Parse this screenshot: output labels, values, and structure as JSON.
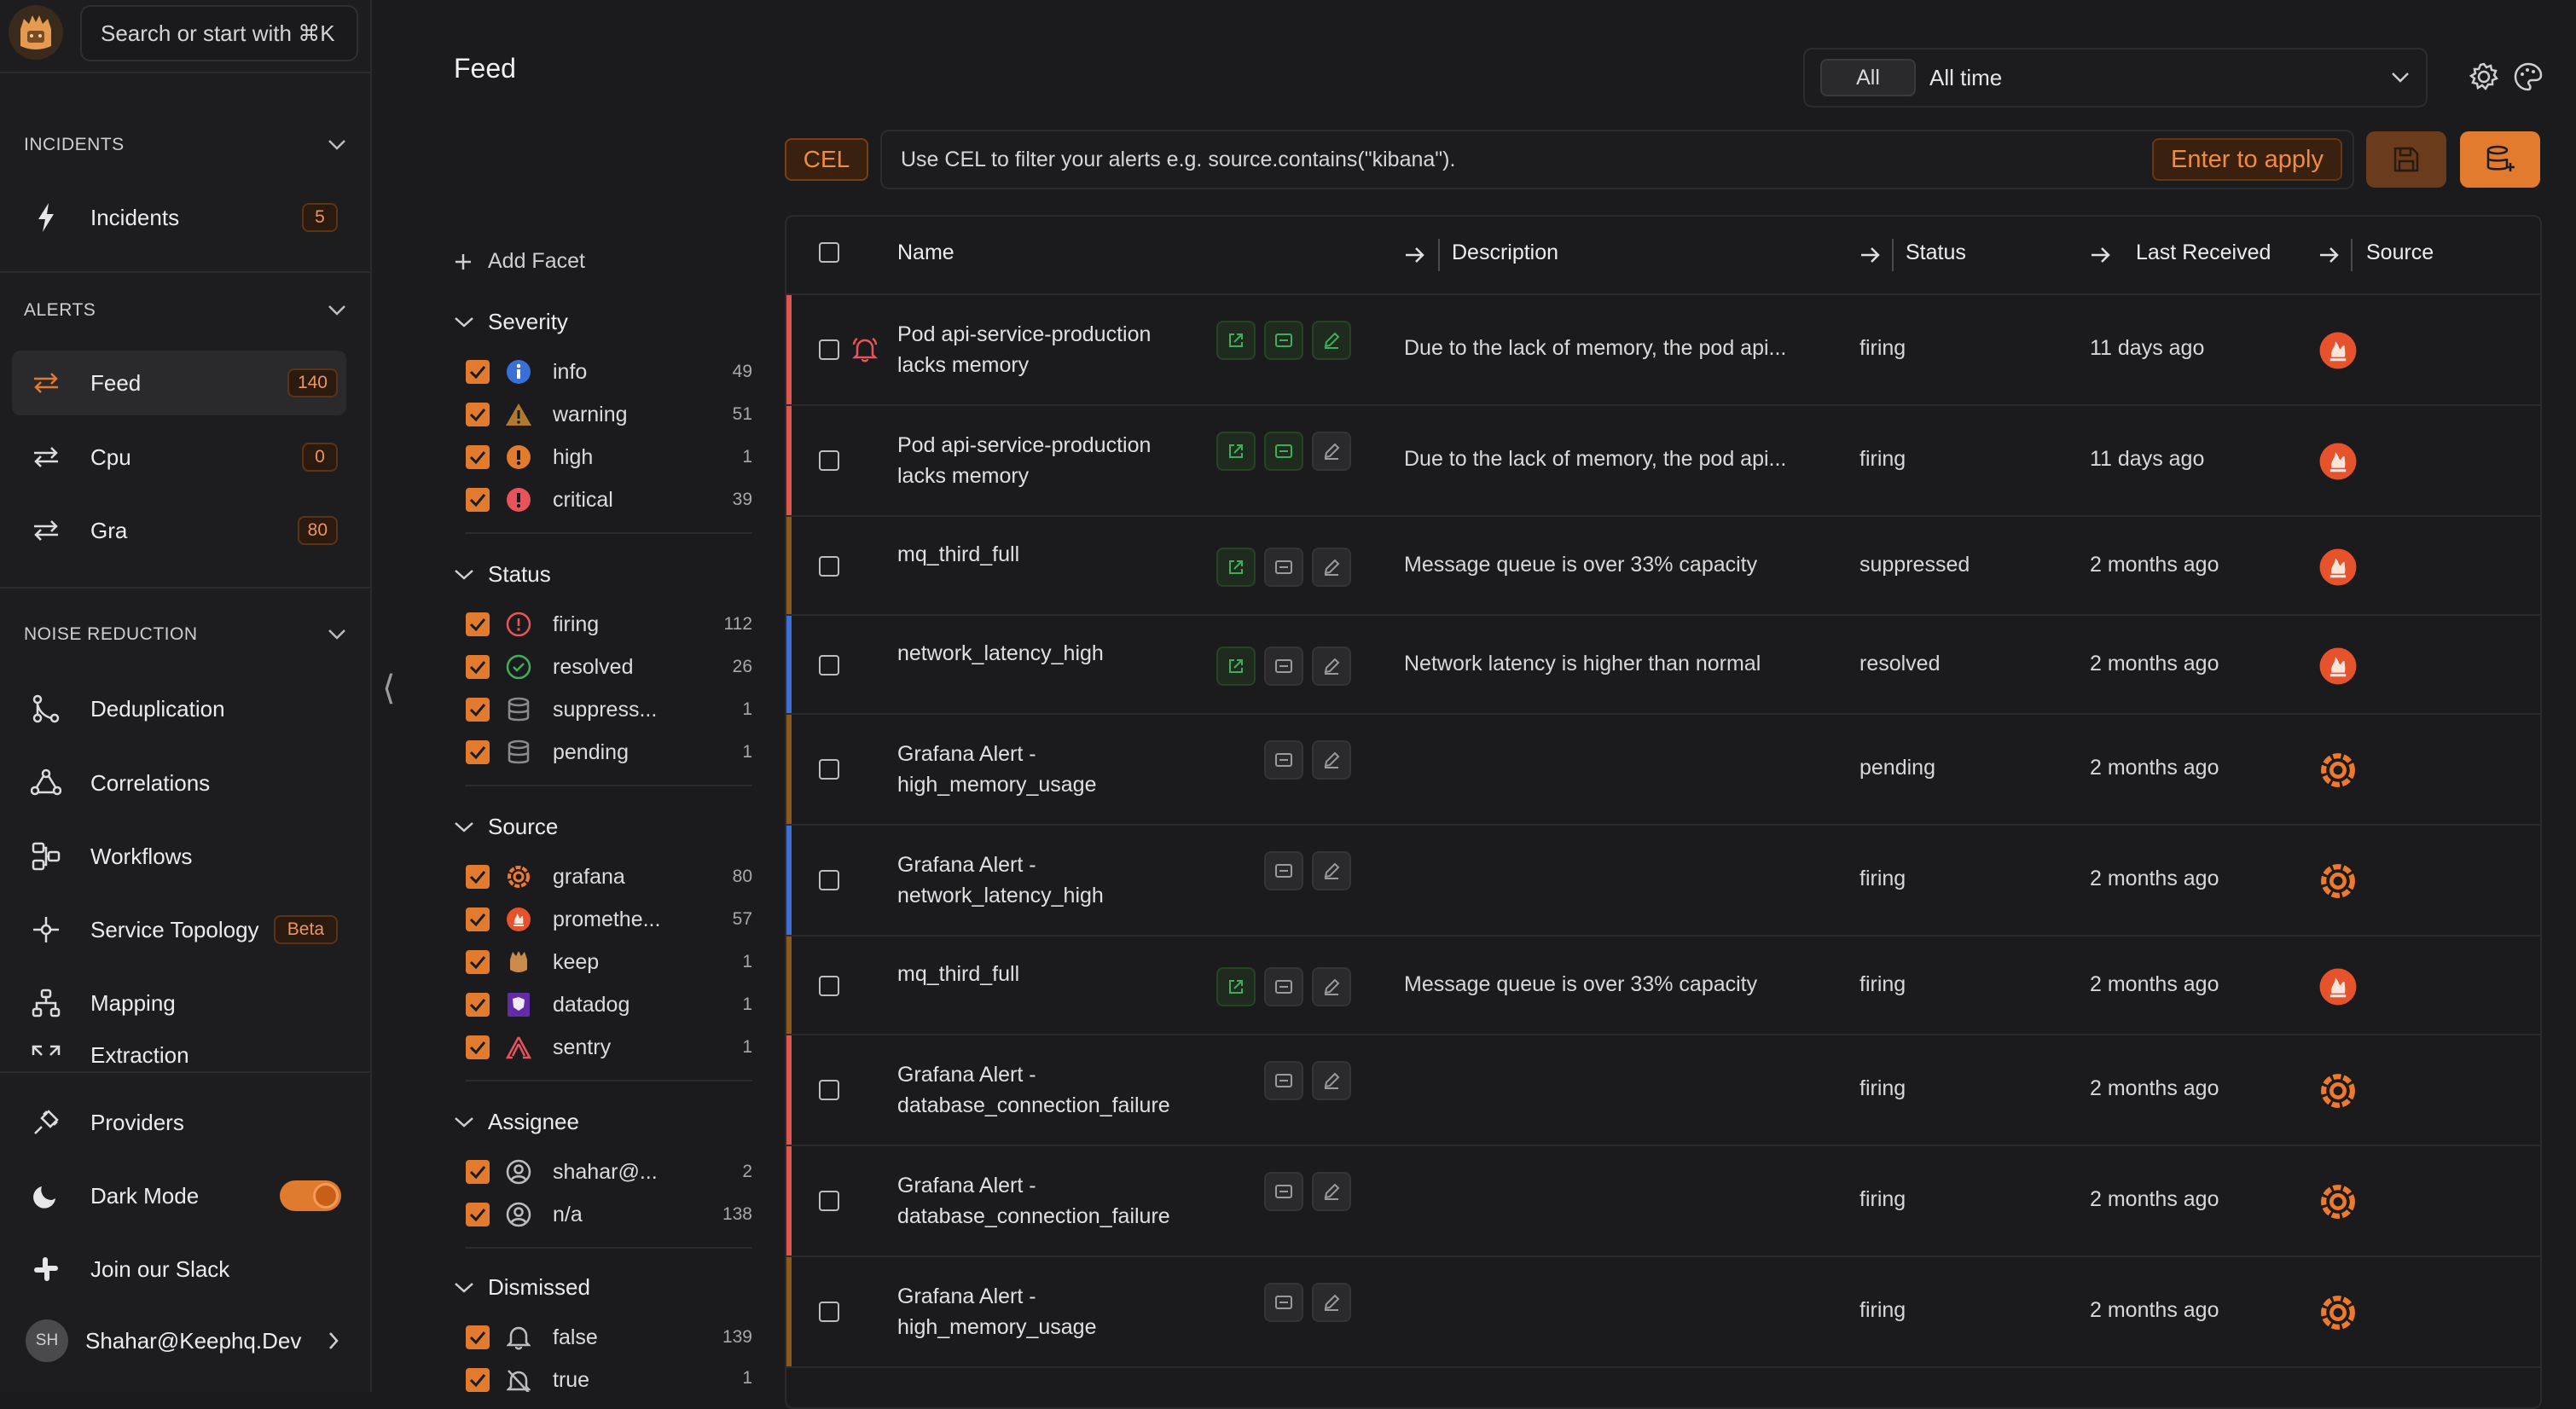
{
  "sidebar": {
    "search_placeholder": "Search or start with ⌘K",
    "sections": {
      "incidents": "INCIDENTS",
      "alerts": "ALERTS",
      "noise": "NOISE REDUCTION"
    },
    "incidents_item": {
      "label": "Incidents",
      "count": "5"
    },
    "alerts_items": [
      {
        "label": "Feed",
        "count": "140"
      },
      {
        "label": "Cpu",
        "count": "0"
      },
      {
        "label": "Gra",
        "count": "80"
      }
    ],
    "noise_items": [
      {
        "label": "Deduplication"
      },
      {
        "label": "Correlations"
      },
      {
        "label": "Workflows"
      },
      {
        "label": "Service Topology",
        "badge": "Beta"
      },
      {
        "label": "Mapping"
      },
      {
        "label": "Extraction"
      }
    ],
    "bottom": {
      "providers": "Providers",
      "dark_mode": "Dark Mode",
      "slack": "Join our Slack",
      "user_initials": "SH",
      "user_name": "Shahar@Keephq.Dev"
    }
  },
  "header": {
    "title": "Feed",
    "time_all": "All",
    "time_value": "All time"
  },
  "cel": {
    "tag": "CEL",
    "placeholder": "Use CEL to filter your alerts e.g. source.contains(\"kibana\").",
    "apply": "Enter to apply"
  },
  "facets": {
    "add": "Add Facet",
    "severity": {
      "title": "Severity",
      "items": [
        {
          "label": "info",
          "count": "49"
        },
        {
          "label": "warning",
          "count": "51"
        },
        {
          "label": "high",
          "count": "1"
        },
        {
          "label": "critical",
          "count": "39"
        }
      ]
    },
    "status": {
      "title": "Status",
      "items": [
        {
          "label": "firing",
          "count": "112"
        },
        {
          "label": "resolved",
          "count": "26"
        },
        {
          "label": "suppress...",
          "count": "1"
        },
        {
          "label": "pending",
          "count": "1"
        }
      ]
    },
    "source": {
      "title": "Source",
      "items": [
        {
          "label": "grafana",
          "count": "80"
        },
        {
          "label": "promethe...",
          "count": "57"
        },
        {
          "label": "keep",
          "count": "1"
        },
        {
          "label": "datadog",
          "count": "1"
        },
        {
          "label": "sentry",
          "count": "1"
        }
      ]
    },
    "assignee": {
      "title": "Assignee",
      "items": [
        {
          "label": "shahar@...",
          "count": "2"
        },
        {
          "label": "n/a",
          "count": "138"
        }
      ]
    },
    "dismissed": {
      "title": "Dismissed",
      "items": [
        {
          "label": "false",
          "count": "139"
        },
        {
          "label": "true",
          "count": "1"
        }
      ]
    }
  },
  "table": {
    "columns": {
      "name": "Name",
      "description": "Description",
      "status": "Status",
      "last_received": "Last Received",
      "source": "Source"
    },
    "rows": [
      {
        "name": "Pod api-service-production lacks memory",
        "description": "Due to the lack of memory, the pod api...",
        "status": "firing",
        "last": "11 days ago",
        "source": "prometheus",
        "stripe": "#e0564f"
      },
      {
        "name": "Pod api-service-production lacks memory",
        "description": "Due to the lack of memory, the pod api...",
        "status": "firing",
        "last": "11 days ago",
        "source": "prometheus",
        "stripe": "#e0564f"
      },
      {
        "name": "mq_third_full",
        "description": "Message queue is over 33% capacity",
        "status": "suppressed",
        "last": "2 months ago",
        "source": "prometheus",
        "stripe": "#8a5a1c"
      },
      {
        "name": "network_latency_high",
        "description": "Network latency is higher than normal",
        "status": "resolved",
        "last": "2 months ago",
        "source": "prometheus",
        "stripe": "#3d6fd6"
      },
      {
        "name": "Grafana Alert - high_memory_usage",
        "description": "",
        "status": "pending",
        "last": "2 months ago",
        "source": "grafana",
        "stripe": "#8a5a1c"
      },
      {
        "name": "Grafana Alert - network_latency_high",
        "description": "",
        "status": "firing",
        "last": "2 months ago",
        "source": "grafana",
        "stripe": "#3d6fd6"
      },
      {
        "name": "mq_third_full",
        "description": "Message queue is over 33% capacity",
        "status": "firing",
        "last": "2 months ago",
        "source": "prometheus",
        "stripe": "#8a5a1c"
      },
      {
        "name": "Grafana Alert - database_connection_failure",
        "description": "",
        "status": "firing",
        "last": "2 months ago",
        "source": "grafana",
        "stripe": "#e0564f"
      },
      {
        "name": "Grafana Alert - database_connection_failure",
        "description": "",
        "status": "firing",
        "last": "2 months ago",
        "source": "grafana",
        "stripe": "#e0564f"
      },
      {
        "name": "Grafana Alert - high_memory_usage",
        "description": "",
        "status": "firing",
        "last": "2 months ago",
        "source": "grafana",
        "stripe": "#8a5a1c"
      }
    ]
  },
  "colors": {
    "accent": "#e27b2e",
    "background": "#1b1b1d"
  }
}
